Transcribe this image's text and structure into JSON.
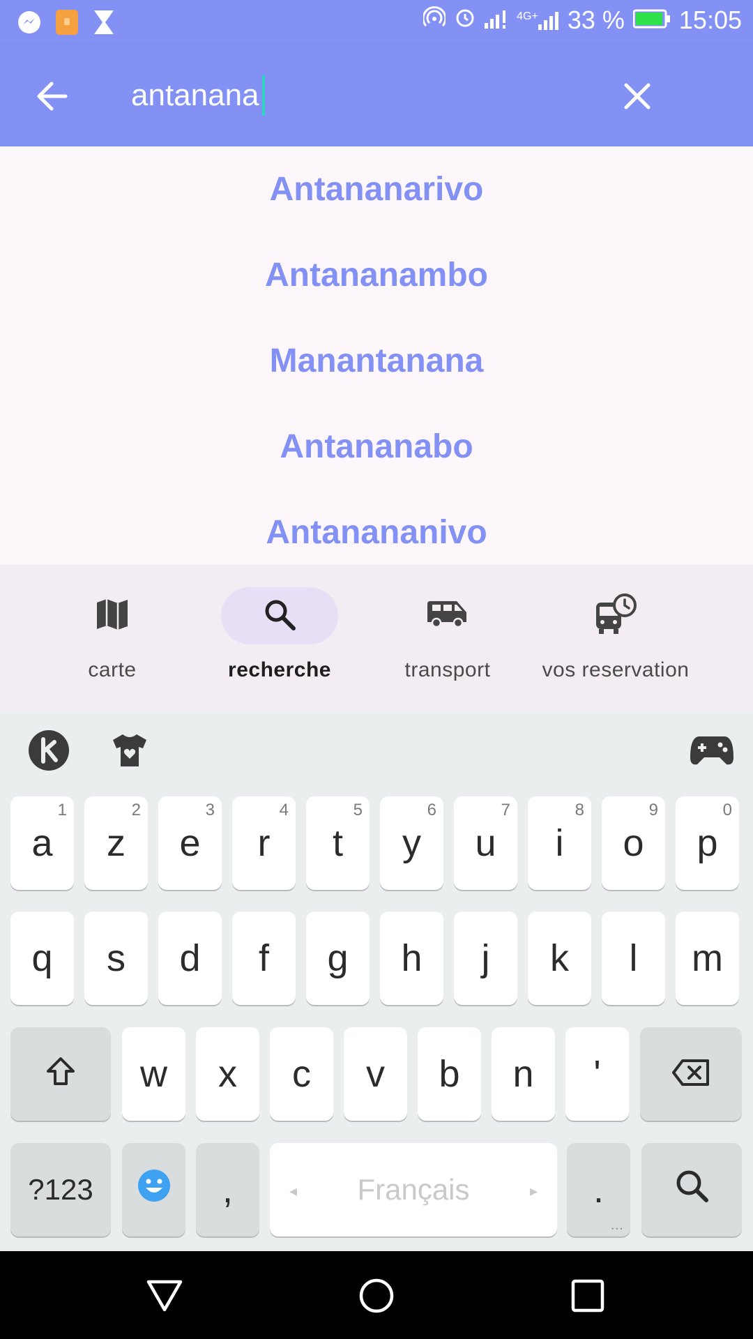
{
  "status_bar": {
    "left_icons": [
      "messenger-icon",
      "wallet-icon",
      "hourglass-icon"
    ],
    "right_icons": [
      "hotspot-icon",
      "alarm-icon",
      "signal-icon",
      "signal-4g-icon"
    ],
    "network_label": "4G+",
    "battery": "33 %",
    "time": "15:05"
  },
  "app_bar": {
    "back_icon": "arrow-back-icon",
    "search_value": "antanana",
    "clear_icon": "close-icon"
  },
  "results": [
    {
      "label": "Antananarivo"
    },
    {
      "label": "Antananambo"
    },
    {
      "label": "Manantanana"
    },
    {
      "label": "Antananabo"
    },
    {
      "label": "Antanananivo"
    }
  ],
  "bottom_nav": {
    "items": [
      {
        "label": "carte",
        "icon": "map-icon",
        "active": false
      },
      {
        "label": "recherche",
        "icon": "search-icon",
        "active": true
      },
      {
        "label": "transport",
        "icon": "van-icon",
        "active": false
      },
      {
        "label": "vos reservation",
        "icon": "bus-clock-icon",
        "active": false
      }
    ]
  },
  "keyboard": {
    "toolbar": [
      "kika-logo-icon",
      "theme-shirt-icon",
      "gamepad-icon"
    ],
    "row1": [
      {
        "key": "a",
        "hint": "1"
      },
      {
        "key": "z",
        "hint": "2"
      },
      {
        "key": "e",
        "hint": "3"
      },
      {
        "key": "r",
        "hint": "4"
      },
      {
        "key": "t",
        "hint": "5"
      },
      {
        "key": "y",
        "hint": "6"
      },
      {
        "key": "u",
        "hint": "7"
      },
      {
        "key": "i",
        "hint": "8"
      },
      {
        "key": "o",
        "hint": "9"
      },
      {
        "key": "p",
        "hint": "0"
      }
    ],
    "row2": [
      "q",
      "s",
      "d",
      "f",
      "g",
      "h",
      "j",
      "k",
      "l",
      "m"
    ],
    "row3": [
      "w",
      "x",
      "c",
      "v",
      "b",
      "n",
      "'"
    ],
    "symbols_label": "?123",
    "comma_label": ",",
    "space_label": "Français",
    "period_label": ".",
    "period_hint": "...",
    "space_arrow_left": "◂",
    "space_arrow_right": "▸"
  },
  "system_nav": [
    "back-triangle-icon",
    "home-circle-icon",
    "recents-square-icon"
  ],
  "colors": {
    "primary": "#8291f3",
    "caret": "#2fd3c0",
    "nav_pill": "#e6dff5"
  }
}
